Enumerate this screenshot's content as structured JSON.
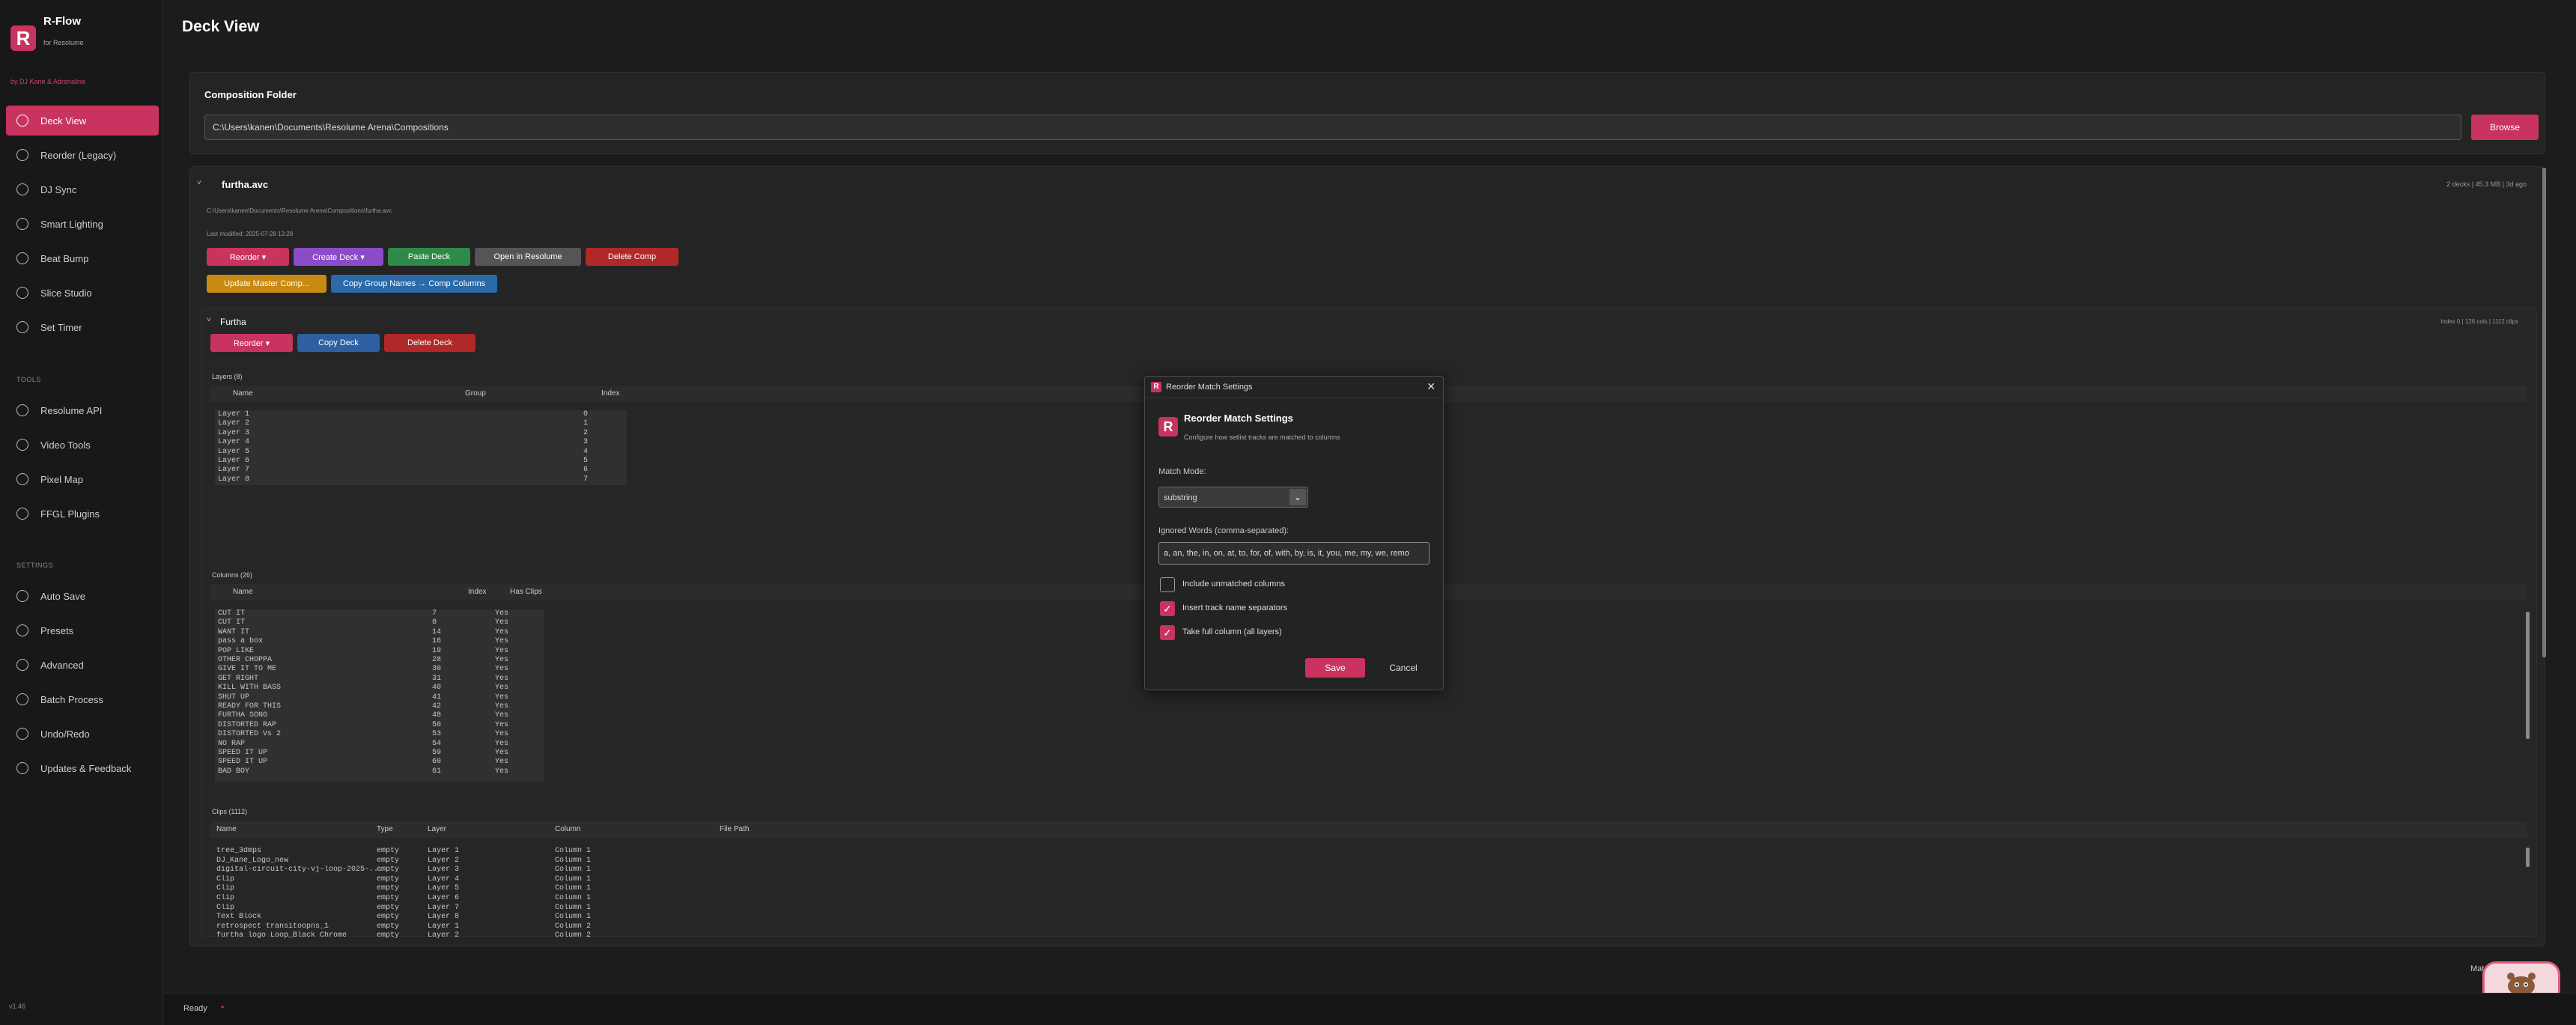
{
  "app": {
    "name": "R-Flow",
    "subtitle": "for Resolume",
    "by": "by DJ Kane & Adrenaline",
    "version": "v1.46",
    "logo_letter": "R"
  },
  "sidebar": {
    "items": [
      {
        "label": "Deck View",
        "icon": "deck-icon"
      },
      {
        "label": "Reorder (Legacy)",
        "icon": "reorder-icon"
      },
      {
        "label": "DJ Sync",
        "icon": "sync-icon"
      },
      {
        "label": "Smart Lighting",
        "icon": "light-icon"
      },
      {
        "label": "Beat Bump",
        "icon": "beat-icon"
      },
      {
        "label": "Slice Studio",
        "icon": "slice-icon"
      },
      {
        "label": "Set Timer",
        "icon": "timer-icon"
      }
    ],
    "tools_label": "TOOLS",
    "tools": [
      {
        "label": "Resolume API",
        "icon": "api-icon"
      },
      {
        "label": "Video Tools",
        "icon": "video-icon"
      },
      {
        "label": "Pixel Map",
        "icon": "pixel-map-icon"
      },
      {
        "label": "FFGL Plugins",
        "icon": "plugin-icon"
      }
    ],
    "settings_label": "SETTINGS",
    "settings": [
      {
        "label": "Auto Save",
        "icon": "save-icon"
      },
      {
        "label": "Presets",
        "icon": "preset-icon"
      },
      {
        "label": "Advanced",
        "icon": "advanced-icon"
      },
      {
        "label": "Batch Process",
        "icon": "batch-icon"
      },
      {
        "label": "Undo/Redo",
        "icon": "undo-icon"
      },
      {
        "label": "Updates & Feedback",
        "icon": "feedback-icon"
      }
    ]
  },
  "main": {
    "title": "Deck View",
    "folder_label": "Composition Folder",
    "folder_path": "C:\\Users\\kanen\\Documents\\Resolume Arena\\Compositions",
    "browse": "Browse",
    "comp": {
      "name": "furtha.avc",
      "stats": "2 decks  |  45.3 MB  |  3d ago",
      "path": "C:\\Users\\kanen\\Documents\\Resolume Arena\\Compositions\\furtha.avc",
      "modified": "Last modified: 2025-07-28 13:28",
      "buttons": [
        "Reorder ▾",
        "Create Deck ▾",
        "Paste Deck",
        "Open in Resolume",
        "Delete Comp"
      ],
      "buttons2": [
        "Update Master Comp...",
        "Copy Group Names → Comp Columns"
      ]
    },
    "deck": {
      "name": "Furtha",
      "stats": "Index 0  |  126 cols  |  1112 clips",
      "buttons": [
        "Reorder ▾",
        "Copy Deck",
        "Delete Deck"
      ]
    },
    "layers": {
      "title": "Layers (8)",
      "headers": [
        "Name",
        "Group",
        "Index"
      ],
      "rows": [
        [
          "Layer 1",
          "",
          "0"
        ],
        [
          "Layer 2",
          "",
          "1"
        ],
        [
          "Layer 3",
          "",
          "2"
        ],
        [
          "Layer 4",
          "",
          "3"
        ],
        [
          "Layer 5",
          "",
          "4"
        ],
        [
          "Layer 6",
          "",
          "5"
        ],
        [
          "Layer 7",
          "",
          "6"
        ],
        [
          "Layer 8",
          "",
          "7"
        ]
      ]
    },
    "columns": {
      "title": "Columns (26)",
      "headers": [
        "Name",
        "Index",
        "Has Clips"
      ],
      "rows": [
        [
          "CUT IT",
          "7",
          "Yes"
        ],
        [
          "CUT IT",
          "8",
          "Yes"
        ],
        [
          "WANT IT",
          "14",
          "Yes"
        ],
        [
          "pass a box",
          "16",
          "Yes"
        ],
        [
          "POP LIKE",
          "19",
          "Yes"
        ],
        [
          "OTHER CHOPPA",
          "28",
          "Yes"
        ],
        [
          "GIVE IT TO ME",
          "30",
          "Yes"
        ],
        [
          "GET RIGHT",
          "31",
          "Yes"
        ],
        [
          "KILL WITH BASS",
          "40",
          "Yes"
        ],
        [
          "SHUT UP",
          "41",
          "Yes"
        ],
        [
          "READY FOR THIS",
          "42",
          "Yes"
        ],
        [
          "FURTHA SONG",
          "48",
          "Yes"
        ],
        [
          "DISTORTED RAP",
          "50",
          "Yes"
        ],
        [
          "DISTORTED Vs 2",
          "53",
          "Yes"
        ],
        [
          "NO RAP",
          "54",
          "Yes"
        ],
        [
          "SPEED IT UP",
          "59",
          "Yes"
        ],
        [
          "SPEED IT UP",
          "60",
          "Yes"
        ],
        [
          "BAD BOY",
          "61",
          "Yes"
        ]
      ]
    },
    "clips": {
      "title": "Clips (1112)",
      "headers": [
        "Name",
        "Type",
        "Layer",
        "Column",
        "File Path"
      ],
      "rows": [
        [
          "tree_3dmps",
          "empty",
          "Layer 1",
          "Column 1",
          ""
        ],
        [
          "DJ_Kane_Logo_new",
          "empty",
          "Layer 2",
          "Column 1",
          ""
        ],
        [
          "digital-circuit-city-vj-loop-2025-...",
          "empty",
          "Layer 3",
          "Column 1",
          ""
        ],
        [
          "Clip",
          "empty",
          "Layer 4",
          "Column 1",
          ""
        ],
        [
          "Clip",
          "empty",
          "Layer 5",
          "Column 1",
          ""
        ],
        [
          "Clip",
          "empty",
          "Layer 6",
          "Column 1",
          ""
        ],
        [
          "Clip",
          "empty",
          "Layer 7",
          "Column 1",
          ""
        ],
        [
          "Text Block",
          "empty",
          "Layer 8",
          "Column 1",
          ""
        ],
        [
          "retrospect transitoopns_1",
          "empty",
          "Layer 1",
          "Column 2",
          ""
        ],
        [
          "furtha logo Loop_Black Chrome",
          "empty",
          "Layer 2",
          "Column 2",
          ""
        ]
      ]
    },
    "mat_label": "Mat"
  },
  "status": {
    "text": "Ready",
    "dot": "•"
  },
  "dialog": {
    "window_title": "Reorder Match Settings",
    "close": "✕",
    "heading": "Reorder Match Settings",
    "description": "Configure how setlist tracks are matched to columns",
    "match_mode_label": "Match Mode:",
    "match_mode_value": "substring",
    "ignored_label": "Ignored Words (comma-separated):",
    "ignored_value": "a, an, the, in, on, at, to, for, of, with, by, is, it, you, me, my, we, remo",
    "checks": [
      {
        "label": "Include unmatched columns",
        "checked": false
      },
      {
        "label": "Insert track name separators",
        "checked": true
      },
      {
        "label": "Take full column (all layers)",
        "checked": true
      }
    ],
    "save": "Save",
    "cancel": "Cancel"
  },
  "colors": {
    "accent": "#c8335f",
    "purple": "#8a4cc8",
    "green": "#2e8a48",
    "red": "#b02828",
    "gold": "#c88a10",
    "blue": "#2a6aa8"
  }
}
